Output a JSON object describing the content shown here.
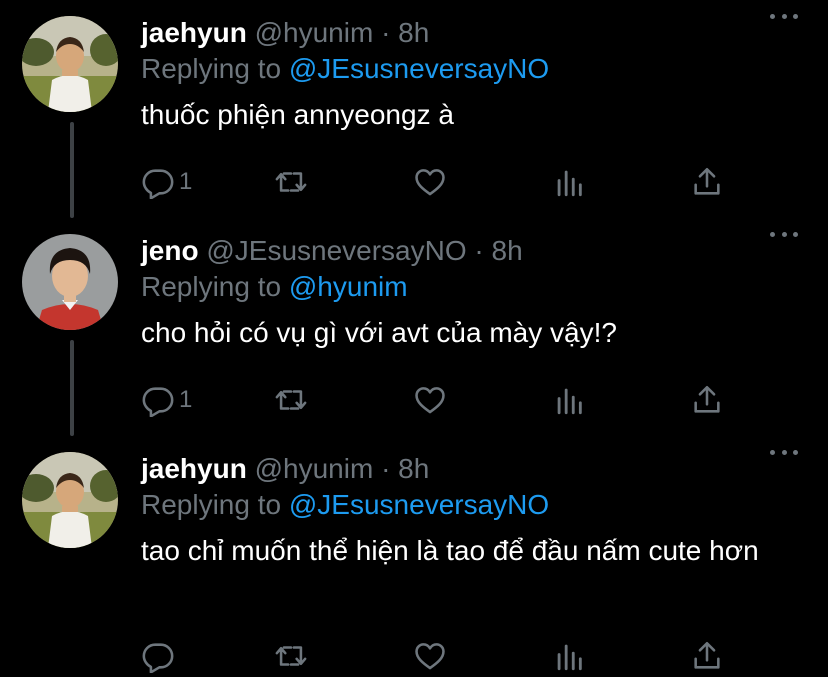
{
  "tweets": [
    {
      "display_name": "jaehyun",
      "handle": "@hyunim",
      "separator": "·",
      "time": "8h",
      "replying_prefix": "Replying to",
      "replying_to": "@JEsusneversayNO",
      "text": "thuốc phiện annyeongz à",
      "reply_count": "1",
      "avatar_icon": "boy-in-park-photo"
    },
    {
      "display_name": "jeno",
      "handle": "@JEsusneversayNO",
      "separator": "·",
      "time": "8h",
      "replying_prefix": "Replying to",
      "replying_to": "@hyunim",
      "text": "cho hỏi có vụ gì với avt của mày vậy!?",
      "reply_count": "1",
      "avatar_icon": "boy-red-shirt-portrait"
    },
    {
      "display_name": "jaehyun",
      "handle": "@hyunim",
      "separator": "·",
      "time": "8h",
      "replying_prefix": "Replying to",
      "replying_to": "@JEsusneversayNO",
      "text": "tao chỉ muốn thể hiện là tao để đầu nấm cute hơn",
      "reply_count": "",
      "avatar_icon": "boy-in-park-photo"
    }
  ],
  "colors": {
    "background": "#000000",
    "text": "#ffffff",
    "muted": "#6e767d",
    "link": "#1d9bf0",
    "thread_line": "#3d4145"
  },
  "icons": [
    "reply-icon",
    "retweet-icon",
    "like-icon",
    "analytics-icon",
    "share-icon",
    "more-icon"
  ]
}
